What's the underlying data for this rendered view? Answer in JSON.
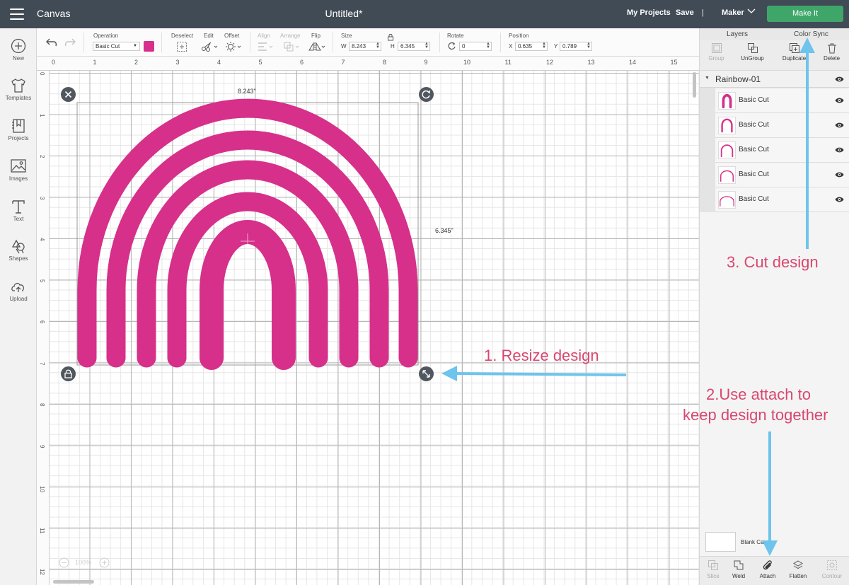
{
  "topbar": {
    "app_title": "Canvas",
    "doc_title": "Untitled*",
    "my_projects": "My Projects",
    "save": "Save",
    "separator": "|",
    "machine": "Maker",
    "make_it": "Make It"
  },
  "leftnav": {
    "items": [
      {
        "label": "New",
        "icon": "plus-circle-icon"
      },
      {
        "label": "Templates",
        "icon": "tshirt-icon"
      },
      {
        "label": "Projects",
        "icon": "bookmark-icon"
      },
      {
        "label": "Images",
        "icon": "image-icon"
      },
      {
        "label": "Text",
        "icon": "text-t-icon"
      },
      {
        "label": "Shapes",
        "icon": "shapes-icon"
      },
      {
        "label": "Upload",
        "icon": "cloud-upload-icon"
      }
    ]
  },
  "toolbar": {
    "operation_label": "Operation",
    "operation_value": "Basic Cut",
    "operation_color": "#d6308a",
    "deselect_label": "Deselect",
    "edit_label": "Edit",
    "offset_label": "Offset",
    "align_label": "Align",
    "arrange_label": "Arrange",
    "flip_label": "Flip",
    "size_label": "Size",
    "w_label": "W",
    "w_value": "8.243",
    "h_label": "H",
    "h_value": "6.345",
    "rotate_label": "Rotate",
    "rotate_value": "0",
    "position_label": "Position",
    "x_label": "X",
    "x_value": "0.635",
    "y_label": "Y",
    "y_value": "0.789"
  },
  "ruler": {
    "top": [
      "0",
      "1",
      "2",
      "3",
      "4",
      "5",
      "6",
      "7",
      "8",
      "9",
      "10",
      "11",
      "12",
      "13",
      "14",
      "15"
    ],
    "left": [
      "0",
      "1",
      "2",
      "3",
      "4",
      "5",
      "6",
      "7",
      "8",
      "9",
      "10",
      "11",
      "12"
    ]
  },
  "canvas": {
    "width_dim": "8.243\"",
    "height_dim": "6.345\"",
    "zoom": "100%",
    "design_color": "#d6308a"
  },
  "rpanel": {
    "tabs": [
      "Layers",
      "Color Sync"
    ],
    "actions": [
      "Group",
      "UnGroup",
      "Duplicate",
      "Delete"
    ],
    "group_name": "Rainbow-01",
    "layers": [
      "Basic Cut",
      "Basic Cut",
      "Basic Cut",
      "Basic Cut",
      "Basic Cut"
    ],
    "blank_canvas": "Blank Canvas",
    "bottom_actions": [
      "Slice",
      "Weld",
      "Attach",
      "Flatten",
      "Contour"
    ]
  },
  "annotations": {
    "step1": "1. Resize design",
    "step2_line1": "2.Use attach to",
    "step2_line2": "keep design together",
    "step3": "3. Cut design",
    "arrow_color": "#6ec4ec",
    "text_color": "#d8476f"
  }
}
